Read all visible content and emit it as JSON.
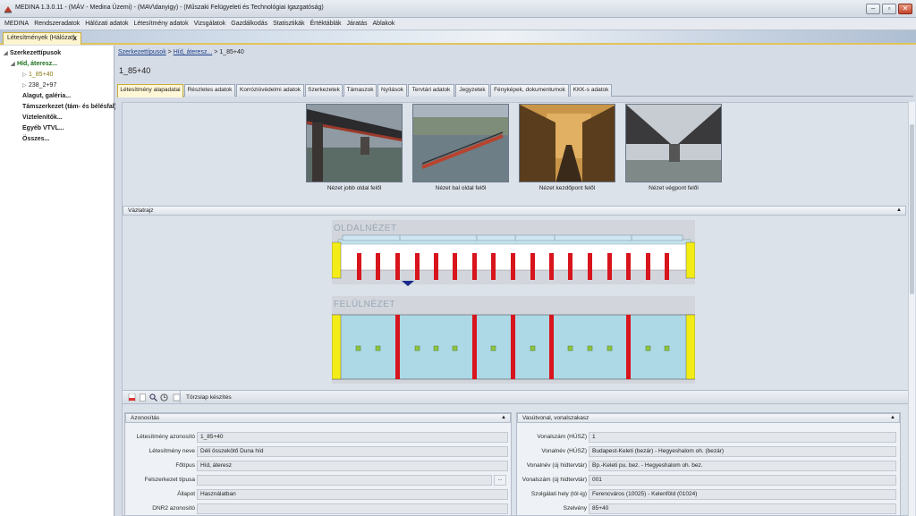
{
  "window": {
    "title": "MEDINA 1.3.0.11 - (MÁV - Medina Üzemi) - (MAV\\danyigy) - (Műszaki Felügyeleti és Technológiai Igazgatóság)",
    "btn_minimize": "–",
    "btn_restore": "▫",
    "btn_close": "✕"
  },
  "menu": [
    "MEDINA",
    "Rendszeradatok",
    "Hálózati adatok",
    "Létesítmény adatok",
    "Vizsgálatok",
    "Gazdálkodás",
    "Statisztikák",
    "Értéktáblák",
    "Járatás",
    "Ablakok"
  ],
  "doc_tab": {
    "label": "Létesítmények (Hálózat)",
    "close": "x"
  },
  "tree": {
    "root": "Szerkezettípusok",
    "group": "Híd, áteresz...",
    "leaf1": "1_85+40",
    "leaf2": "238_2+97",
    "item_alagut": "Alagut, galéria...",
    "item_tamszerkezet": "Támszerkezet (tám- és bélésfal)...",
    "item_viztelenitok": "Víztelenítők...",
    "item_egyeb": "Egyéb VTVL...",
    "item_osszes": "Összes..."
  },
  "breadcrumb": {
    "part1": "Szerkezettípusok",
    "sep1": ">",
    "part2": "Híd, áteresz...",
    "sep2": ">",
    "part3": "1_85+40"
  },
  "page_title": "1_85+40",
  "tabs": [
    "Létesítmény alapadatai",
    "Részletes adatok",
    "Korrózióvédelmi adatok",
    "Szerkezetek",
    "Támaszok",
    "Nyílások",
    "Tervtári adatok",
    "Jegyzetek",
    "Fényképek, dokumentumok",
    "KKK-s adatok"
  ],
  "photos": [
    "Nézet jobb oldal felől",
    "Nézet bal oldal felől",
    "Nézet kezdőpont felől",
    "Nézet végpont felől"
  ],
  "sketch": {
    "section_title": "Vázlatrajz",
    "side_label": "OLDALNÉZET",
    "top_label": "FELÜLNÉZET",
    "collapse": "▲"
  },
  "toolbar": {
    "label": "Törzslap készítés"
  },
  "identification": {
    "title": "Azonosítás",
    "collapse": "▲",
    "fields": [
      {
        "label": "Létesítmény azonosító",
        "value": "1_85+40"
      },
      {
        "label": "Létesítmény neve",
        "value": "Déli összekötő Duna híd"
      },
      {
        "label": "Főtípus",
        "value": "Híd, áteresz"
      },
      {
        "label": "Felszerkezet típusa",
        "value": ""
      },
      {
        "label": "Állapot",
        "value": "Használatban"
      },
      {
        "label": "DNR2 azonosító",
        "value": ""
      }
    ],
    "browse_button": "..."
  },
  "railway": {
    "title": "Vasútvonal, vonalszakasz",
    "collapse": "▲",
    "fields": [
      {
        "label": "Vonalszám (HÚSZ)",
        "value": "1"
      },
      {
        "label": "Vonalnév (HÚSZ)",
        "value": "Budapest-Keleti (bezár) - Hegyeshalom oh. (bezár)"
      },
      {
        "label": "Vonalnév (új hídtervtár)",
        "value": "Bp.-Keleti pu. bez. - Hegyeshalom oh. bez."
      },
      {
        "label": "Vonalszám (új hídtervtár)",
        "value": "001"
      },
      {
        "label": "Szolgálati hely (tól-ig)",
        "value": "Ferencváros (10025) - Kelenföld (01024)"
      },
      {
        "label": "Szelvény",
        "value": "85+40"
      }
    ]
  }
}
